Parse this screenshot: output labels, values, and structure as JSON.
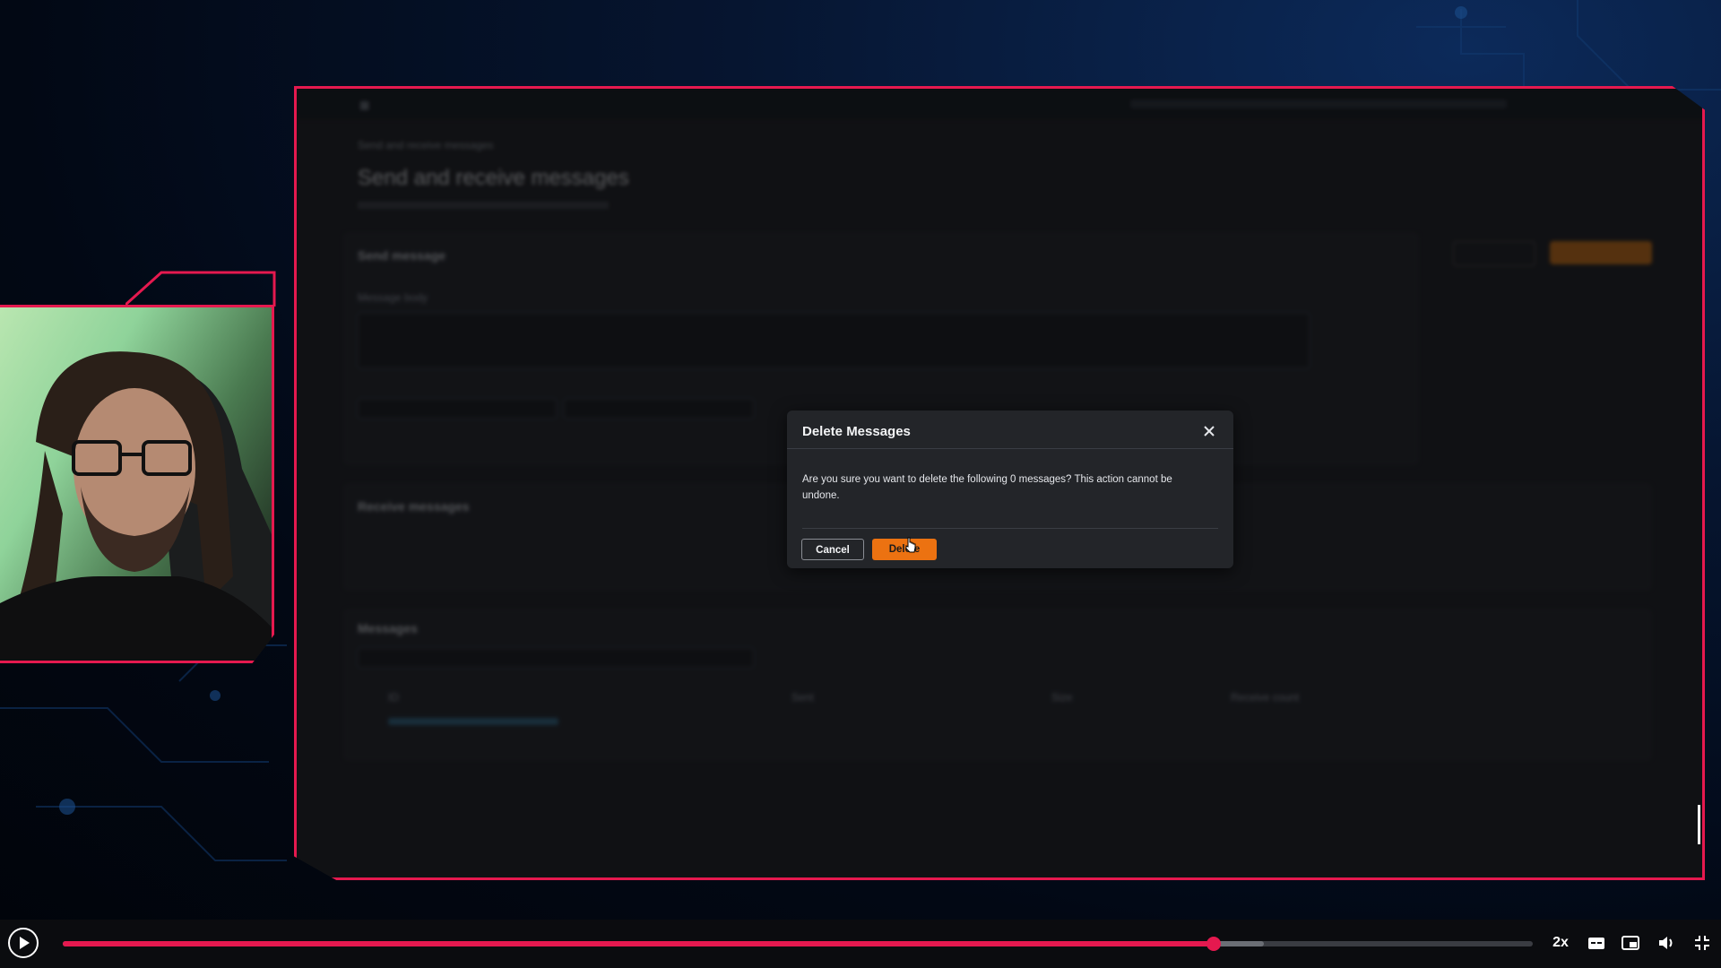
{
  "console": {
    "breadcrumb": "Send and receive messages",
    "page_title": "Send and receive messages",
    "send_section": "Send message",
    "message_body_label": "Message body",
    "receive_section": "Receive messages",
    "messages_section": "Messages",
    "table_columns": [
      "ID",
      "Sent",
      "Size",
      "Receive count"
    ],
    "table_rows": [
      {
        "id": "",
        "sent": "",
        "size": "",
        "count": ""
      }
    ]
  },
  "modal": {
    "title": "Delete Messages",
    "body": "Are you sure you want to delete the following 0 messages? This action cannot be undone.",
    "cancel_label": "Cancel",
    "delete_label": "Delete"
  },
  "player": {
    "speed_label": "2x",
    "progress_fraction": 0.783,
    "buffer_fraction": 0.817
  },
  "colors": {
    "frame_accent": "#e5194f",
    "aws_orange": "#ec7211"
  },
  "icons": {
    "close": "close-icon",
    "play": "play-icon",
    "captions": "captions-icon",
    "pip": "picture-in-picture-icon",
    "volume": "volume-icon",
    "fullscreen": "exit-fullscreen-icon",
    "cursor": "mouse-cursor-icon"
  }
}
